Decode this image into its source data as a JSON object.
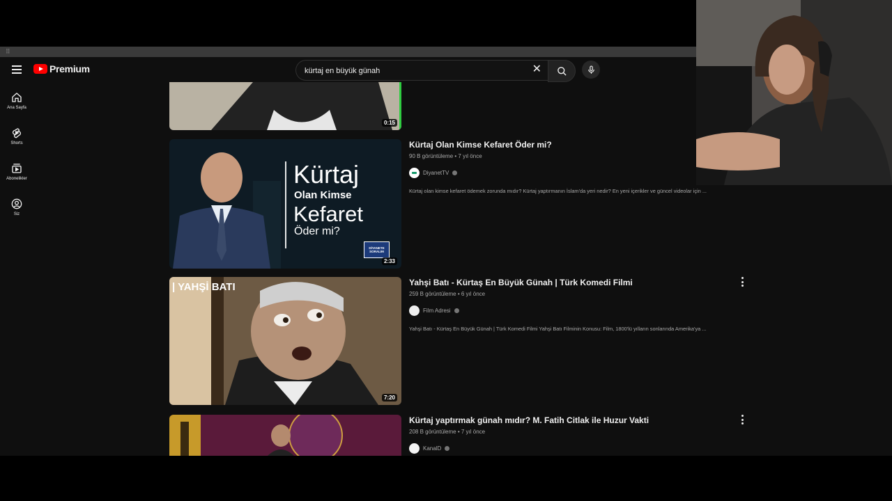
{
  "app": {
    "brand": "Premium"
  },
  "search": {
    "value": "kürtaj en büyük günah",
    "clear_label": "✕"
  },
  "sidebar": {
    "items": [
      {
        "label": "Ana Sayfa",
        "icon": "home-icon"
      },
      {
        "label": "Shorts",
        "icon": "shorts-icon"
      },
      {
        "label": "Abonelikler",
        "icon": "subscriptions-icon"
      },
      {
        "label": "Siz",
        "icon": "account-icon"
      }
    ]
  },
  "results": [
    {
      "duration": "0:15"
    },
    {
      "title": "Kürtaj Olan Kimse Kefaret Öder mi?",
      "views": "90 B görüntüleme",
      "age": "7 yıl önce",
      "channel": "DiyanetTV",
      "description": "Kürtaj olan kimse kefaret ödemek zorunda mıdır? Kürtaj yaptırmanın İslam'da yeri nedir? En yeni içerikler ve güncel videolar için ...",
      "duration": "2:33",
      "thumb_text": {
        "line1": "Kürtaj",
        "line2": "Olan Kimse",
        "line3": "Kefaret",
        "line4": "Öder mi?",
        "badge1": "DİYANETE",
        "badge2": "SORALIM"
      }
    },
    {
      "title": "Yahşi Batı - Kürtaş En Büyük Günah | Türk Komedi Filmi",
      "views": "259 B görüntüleme",
      "age": "6 yıl önce",
      "channel": "Film Adresi",
      "description": "Yahşi Batı - Kürtaş En Büyük Günah | Türk Komedi Filmi Yahşi Batı Filminin Konusu: Film, 1800'lü yılların sonlarında Amerika'ya ...",
      "duration": "7:20",
      "thumb_text": {
        "line1": "| YAHŞİ BATI"
      }
    },
    {
      "title": "Kürtaj yaptırmak günah mıdır? M. Fatih Citlak ile Huzur Vakti",
      "views": "208 B görüntüleme",
      "age": "7 yıl önce",
      "channel": "KanalD"
    }
  ],
  "colors": {
    "background": "#0f0f0f",
    "accent": "#ff0000",
    "progress": "#2ecc40"
  }
}
